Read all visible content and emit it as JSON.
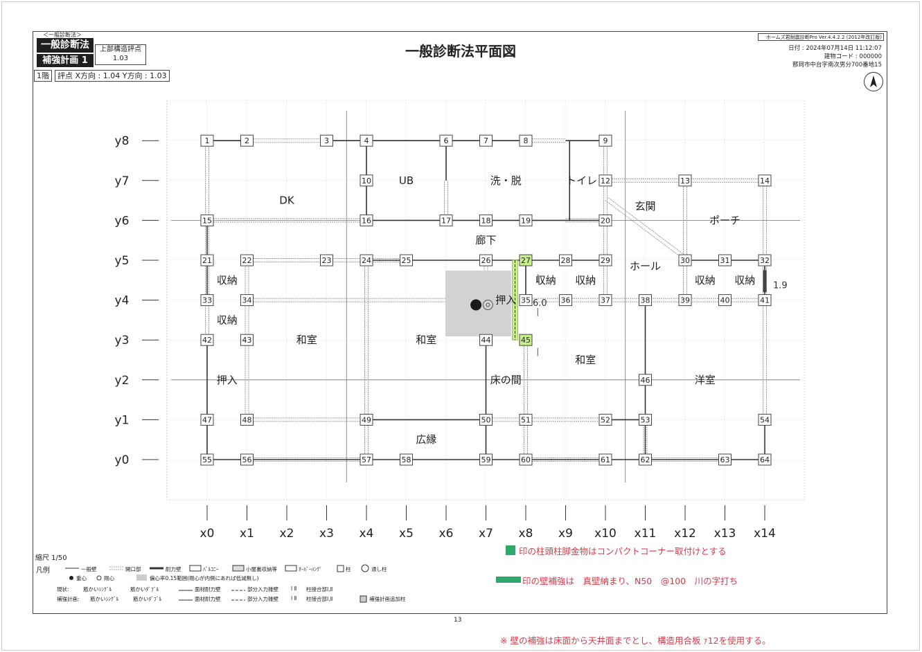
{
  "header": {
    "method_small": "＜一般診断法＞",
    "method_badge": "一般診断法",
    "plan_badge": "補強計画 1",
    "score_label": "上部構造評点",
    "score_value": "1.03",
    "title": "一般診断法平面図",
    "software": "ホームズ君耐震診断Pro Ver.4.4.2.2 (2012年改訂版)",
    "date": "日付 : 2024年07月14日 11:12:07",
    "building_code": "建物コード : 000000",
    "address": "那珂市中台字南次男分700番地15",
    "floor": "1階",
    "floor_score": "評点 X方向 : 1.04  Y方向 : 1.03"
  },
  "plan": {
    "x_axis": [
      "x0",
      "x1",
      "x2",
      "x3",
      "x4",
      "x5",
      "x6",
      "x7",
      "x8",
      "x9",
      "x10",
      "x11",
      "x12",
      "x13",
      "x14"
    ],
    "y_axis": [
      "y0",
      "y1",
      "y2",
      "y3",
      "y4",
      "y5",
      "y6",
      "y7",
      "y8"
    ],
    "columns": [
      {
        "n": "1",
        "x": 0,
        "y": 8
      },
      {
        "n": "2",
        "x": 1,
        "y": 8
      },
      {
        "n": "3",
        "x": 3,
        "y": 8
      },
      {
        "n": "4",
        "x": 4,
        "y": 8
      },
      {
        "n": "6",
        "x": 6,
        "y": 8
      },
      {
        "n": "7",
        "x": 7,
        "y": 8
      },
      {
        "n": "8",
        "x": 8,
        "y": 8
      },
      {
        "n": "9",
        "x": 10,
        "y": 8
      },
      {
        "n": "10",
        "x": 4,
        "y": 7
      },
      {
        "n": "12",
        "x": 10,
        "y": 7
      },
      {
        "n": "13",
        "x": 12,
        "y": 7
      },
      {
        "n": "14",
        "x": 14,
        "y": 7
      },
      {
        "n": "15",
        "x": 0,
        "y": 6
      },
      {
        "n": "16",
        "x": 4,
        "y": 6
      },
      {
        "n": "17",
        "x": 6,
        "y": 6
      },
      {
        "n": "18",
        "x": 7,
        "y": 6
      },
      {
        "n": "19",
        "x": 8,
        "y": 6
      },
      {
        "n": "20",
        "x": 10,
        "y": 6
      },
      {
        "n": "21",
        "x": 0,
        "y": 5
      },
      {
        "n": "22",
        "x": 1,
        "y": 5
      },
      {
        "n": "23",
        "x": 3,
        "y": 5
      },
      {
        "n": "24",
        "x": 4,
        "y": 5
      },
      {
        "n": "25",
        "x": 5,
        "y": 5
      },
      {
        "n": "26",
        "x": 7,
        "y": 5
      },
      {
        "n": "27",
        "x": 8,
        "y": 5,
        "hl": true
      },
      {
        "n": "28",
        "x": 9,
        "y": 5
      },
      {
        "n": "29",
        "x": 10,
        "y": 5
      },
      {
        "n": "30",
        "x": 12,
        "y": 5
      },
      {
        "n": "31",
        "x": 13,
        "y": 5
      },
      {
        "n": "32",
        "x": 14,
        "y": 5
      },
      {
        "n": "33",
        "x": 0,
        "y": 4
      },
      {
        "n": "34",
        "x": 1,
        "y": 4
      },
      {
        "n": "35",
        "x": 8,
        "y": 4
      },
      {
        "n": "36",
        "x": 9,
        "y": 4
      },
      {
        "n": "37",
        "x": 10,
        "y": 4
      },
      {
        "n": "38",
        "x": 11,
        "y": 4
      },
      {
        "n": "39",
        "x": 12,
        "y": 4
      },
      {
        "n": "40",
        "x": 13,
        "y": 4
      },
      {
        "n": "41",
        "x": 14,
        "y": 4
      },
      {
        "n": "42",
        "x": 0,
        "y": 3
      },
      {
        "n": "43",
        "x": 1,
        "y": 3
      },
      {
        "n": "44",
        "x": 7,
        "y": 3
      },
      {
        "n": "45",
        "x": 8,
        "y": 3,
        "hl": true
      },
      {
        "n": "46",
        "x": 11,
        "y": 2
      },
      {
        "n": "47",
        "x": 0,
        "y": 1
      },
      {
        "n": "48",
        "x": 1,
        "y": 1
      },
      {
        "n": "49",
        "x": 4,
        "y": 1
      },
      {
        "n": "50",
        "x": 7,
        "y": 1
      },
      {
        "n": "51",
        "x": 8,
        "y": 1
      },
      {
        "n": "52",
        "x": 10,
        "y": 1
      },
      {
        "n": "53",
        "x": 11,
        "y": 1
      },
      {
        "n": "54",
        "x": 14,
        "y": 1
      },
      {
        "n": "55",
        "x": 0,
        "y": 0
      },
      {
        "n": "56",
        "x": 1,
        "y": 0
      },
      {
        "n": "57",
        "x": 4,
        "y": 0
      },
      {
        "n": "58",
        "x": 5,
        "y": 0
      },
      {
        "n": "59",
        "x": 7,
        "y": 0
      },
      {
        "n": "60",
        "x": 8,
        "y": 0
      },
      {
        "n": "61",
        "x": 10,
        "y": 0
      },
      {
        "n": "62",
        "x": 11,
        "y": 0
      },
      {
        "n": "63",
        "x": 13,
        "y": 0
      },
      {
        "n": "64",
        "x": 14,
        "y": 0
      }
    ],
    "rooms": [
      {
        "label": "DK",
        "x": 2,
        "y": 6.5
      },
      {
        "label": "UB",
        "x": 5,
        "y": 7
      },
      {
        "label": "洗・脱",
        "x": 7.5,
        "y": 7
      },
      {
        "label": "トイレ",
        "x": 9.4,
        "y": 7
      },
      {
        "label": "玄関",
        "x": 11,
        "y": 6.35
      },
      {
        "label": "ポーチ",
        "x": 13,
        "y": 6
      },
      {
        "label": "廊下",
        "x": 7,
        "y": 5.5
      },
      {
        "label": "ホール",
        "x": 11,
        "y": 4.85
      },
      {
        "label": "収納",
        "x": 0.5,
        "y": 4.5
      },
      {
        "label": "収納",
        "x": 0.5,
        "y": 3.5
      },
      {
        "label": "収納",
        "x": 8.5,
        "y": 4.5
      },
      {
        "label": "収納",
        "x": 9.5,
        "y": 4.5
      },
      {
        "label": "収納",
        "x": 12.5,
        "y": 4.5
      },
      {
        "label": "収納",
        "x": 13.5,
        "y": 4.5
      },
      {
        "label": "押入",
        "x": 7.5,
        "y": 4
      },
      {
        "label": "和室",
        "x": 2.5,
        "y": 3
      },
      {
        "label": "和室",
        "x": 5.5,
        "y": 3
      },
      {
        "label": "和室",
        "x": 9.5,
        "y": 2.5
      },
      {
        "label": "押入",
        "x": 0.5,
        "y": 2
      },
      {
        "label": "床の間",
        "x": 7.5,
        "y": 2
      },
      {
        "label": "洋室",
        "x": 12.5,
        "y": 2
      },
      {
        "label": "広縁",
        "x": 5.5,
        "y": 0.5
      }
    ],
    "annotations": {
      "wall_value_1": "1.9",
      "wall_value_2": "6.0"
    }
  },
  "legend": {
    "scale": "縮尺 1/50",
    "title": "凡例",
    "row1": [
      "一般壁",
      "開口部",
      "耐力壁",
      "ﾊﾞﾙｺﾆｰ",
      "小屋裏収納等",
      "ｵｰﾊﾞｰﾊﾝｸﾞ",
      "柱",
      "通し柱"
    ],
    "row2": [
      "重心",
      "剛心",
      "偏心率0.15範囲(剛心が内側にあれば低減無し)"
    ],
    "row3_label": "現状:",
    "row3": [
      "筋かいｼﾝｸﾞﾙ",
      "筋かいﾀﾞﾌﾞﾙ",
      "面材耐力壁",
      "部分入力雑壁",
      "柱接合部Ⅰ,Ⅱ"
    ],
    "row4_label": "補強計画:",
    "row4": [
      "筋かいｼﾝｸﾞﾙ",
      "筋かいﾀﾞﾌﾞﾙ",
      "面材耐力壁",
      "部分入力雑壁",
      "柱接合部Ⅰ,Ⅱ",
      "補強計画追加柱"
    ],
    "roman": "Ⅰ Ⅱ"
  },
  "notes": {
    "note1": "印の柱頭柱脚金物はコンパクトコーナー取付けとする",
    "note2": "印の壁補強は　真壁納まり、N50　@100　川の字打ち",
    "note3": "※ 壁の補強は床面から天井面までとし、構造用合板 ｧ12を使用する。"
  },
  "page_number": "13",
  "colors": {
    "highlight": "#c8f08a",
    "green": "#2fa86b",
    "note_red": "#d43a4a"
  }
}
